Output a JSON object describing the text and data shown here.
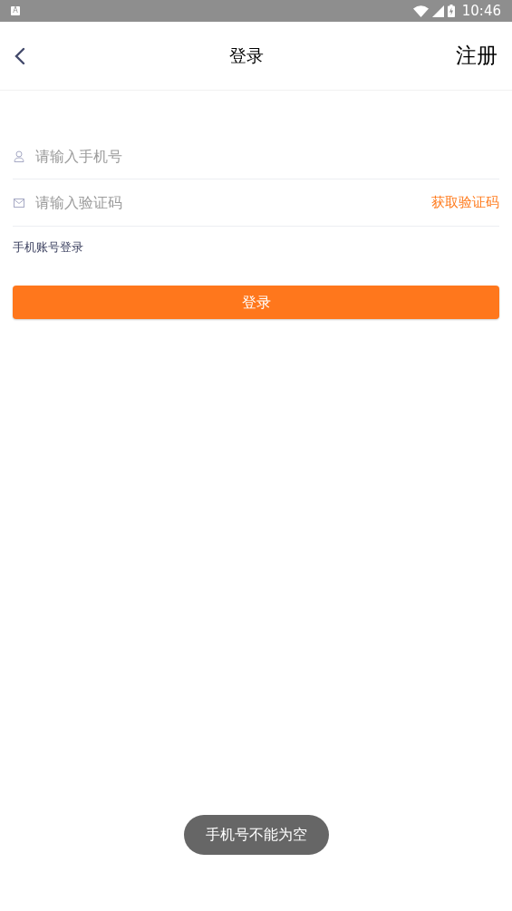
{
  "status_bar": {
    "time": "10:46",
    "notification_icon": "A"
  },
  "header": {
    "title": "登录",
    "action": "注册"
  },
  "form": {
    "phone": {
      "placeholder": "请输入手机号"
    },
    "code": {
      "placeholder": "请输入验证码",
      "action": "获取验证码"
    },
    "mode_label": "手机账号登录",
    "submit": "登录"
  },
  "toast": "手机号不能为空"
}
